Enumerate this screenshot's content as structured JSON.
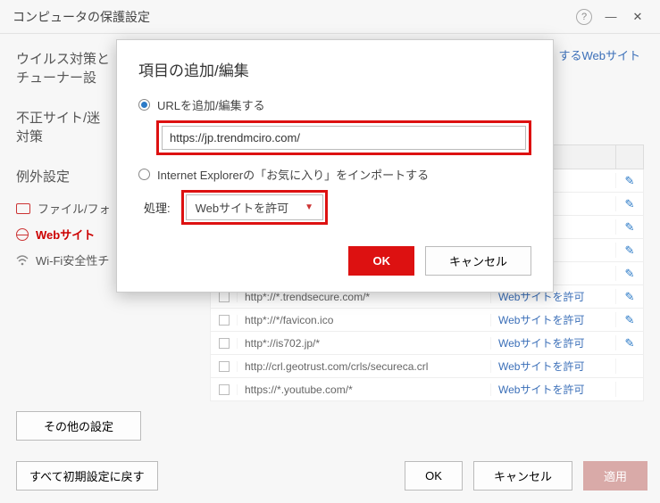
{
  "window": {
    "title": "コンピュータの保護設定"
  },
  "sidebar": {
    "g1": "ウイルス対策と",
    "g2": "チューナー設",
    "g3": "不正サイト/迷",
    "g4": "対策",
    "g5": "例外設定",
    "items": [
      {
        "label": "ファイル/フォ"
      },
      {
        "label": "Webサイト"
      },
      {
        "label": "Wi-Fi安全性チ"
      }
    ]
  },
  "content": {
    "right_label_suffix": "するWebサイト"
  },
  "table": {
    "rows": [
      {
        "url": "",
        "action": "トを許可",
        "edit": true
      },
      {
        "url": "",
        "action": "トを許可",
        "edit": true
      },
      {
        "url": "",
        "action": "トを許可",
        "edit": true
      },
      {
        "url": "",
        "action": "トを許可",
        "edit": true
      },
      {
        "url": "",
        "action": "トを許可",
        "edit": true
      },
      {
        "url": "http*://*.trendsecure.com/*",
        "action": "Webサイトを許可",
        "edit": true
      },
      {
        "url": "http*://*/favicon.ico",
        "action": "Webサイトを許可",
        "edit": true
      },
      {
        "url": "http*://is702.jp/*",
        "action": "Webサイトを許可",
        "edit": true
      },
      {
        "url": "http://crl.geotrust.com/crls/secureca.crl",
        "action": "Webサイトを許可",
        "edit": false
      },
      {
        "url": "https://*.youtube.com/*",
        "action": "Webサイトを許可",
        "edit": false
      }
    ]
  },
  "buttons": {
    "other": "その他の設定",
    "reset": "すべて初期設定に戻す",
    "ok": "OK",
    "cancel": "キャンセル",
    "apply": "適用"
  },
  "modal": {
    "title": "項目の追加/編集",
    "radio1": "URLを追加/編集する",
    "url_value": "https://jp.trendmciro.com/",
    "radio2": "Internet Explorerの「お気に入り」をインポートする",
    "action_label": "処理:",
    "action_value": "Webサイトを許可",
    "ok": "OK",
    "cancel": "キャンセル"
  }
}
